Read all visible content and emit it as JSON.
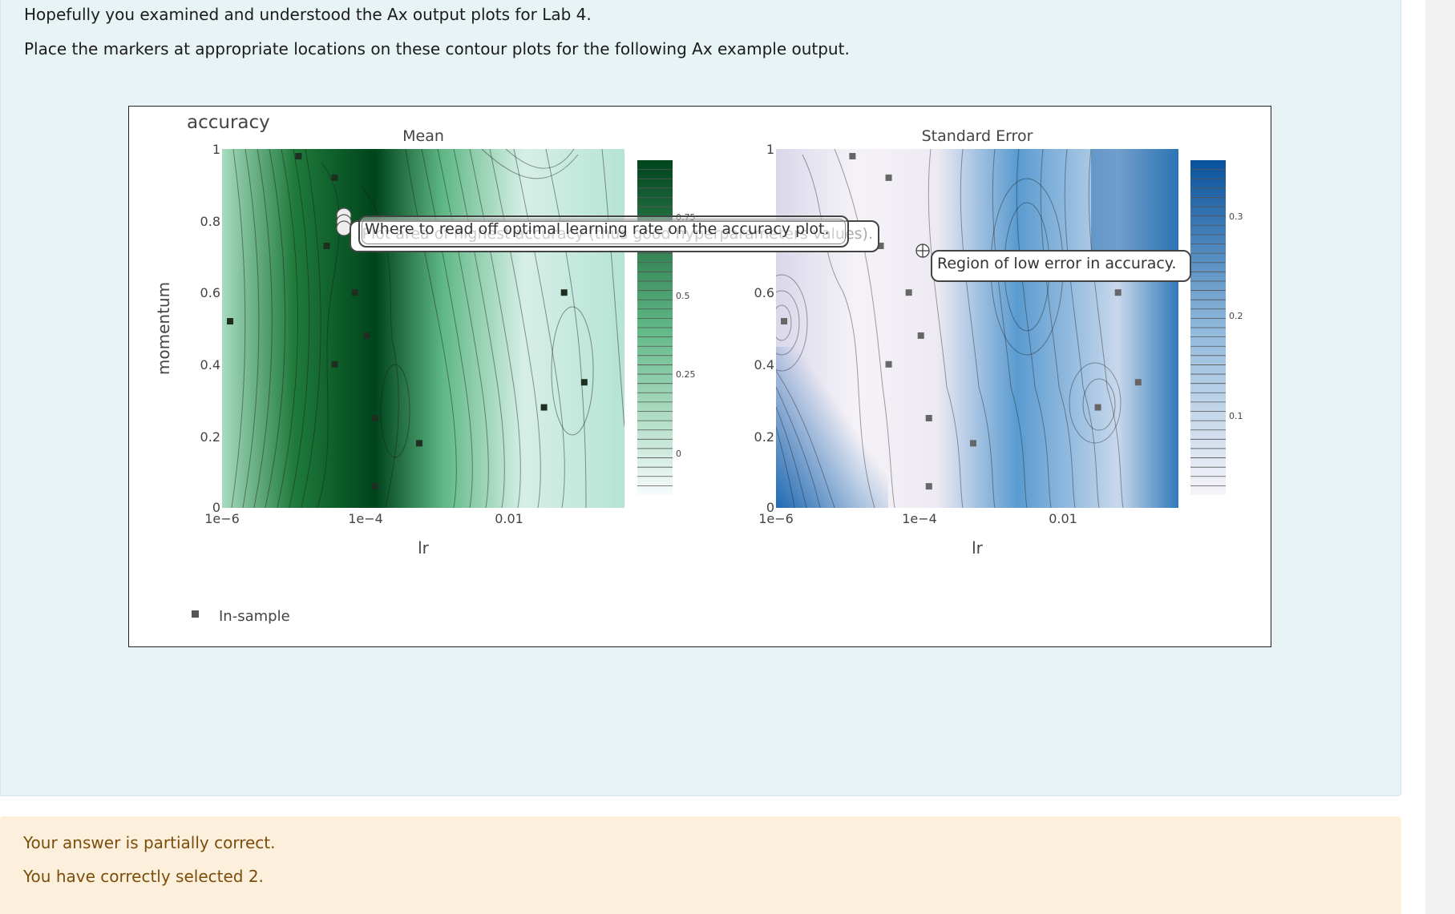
{
  "question": {
    "line1": "Hopefully you examined and understood the Ax output plots for Lab 4.",
    "line2": "Place the markers at appropriate locations on these contour plots for the following Ax example output."
  },
  "plot": {
    "title": "accuracy",
    "left_subtitle": "Mean",
    "right_subtitle": "Standard Error",
    "y_axis_label": "momentum",
    "x_axis_label": "lr",
    "y_ticks": [
      "1",
      "0.8",
      "0.6",
      "0.4",
      "0.2",
      "0"
    ],
    "x_ticks": [
      "1e−6",
      "1e−4",
      "0.01"
    ],
    "left_colorbar_ticks": [
      "0.75",
      "0.5",
      "0.25",
      "0"
    ],
    "right_colorbar_ticks": [
      "0.3",
      "0.2",
      "0.1"
    ],
    "legend_label": "In-sample",
    "left_colors": {
      "dark": "#00441b",
      "mid": "#41ab5d",
      "light": "#e5f5f9"
    },
    "right_colors": {
      "dark": "#08519c",
      "mid": "#6baed6",
      "light": "#f5f2f7"
    }
  },
  "markers": {
    "label_back": "Plot area of highest accuracy (thus good hyperparameters values).",
    "label_front": "Where to read off optimal learning rate on the accuracy plot.",
    "label_right": "Region of low error in accuracy."
  },
  "feedback": {
    "line1": "Your answer is partially correct.",
    "line2": "You have correctly selected 2."
  },
  "sample_points": {
    "mean": [
      [
        0.19,
        0.98
      ],
      [
        0.28,
        0.92
      ],
      [
        0.26,
        0.73
      ],
      [
        0.33,
        0.6
      ],
      [
        0.36,
        0.48
      ],
      [
        0.28,
        0.4
      ],
      [
        0.38,
        0.25
      ],
      [
        0.49,
        0.18
      ],
      [
        0.38,
        0.06
      ],
      [
        0.85,
        0.6
      ],
      [
        0.8,
        0.28
      ],
      [
        0.9,
        0.35
      ],
      [
        0.02,
        0.52
      ]
    ],
    "se": [
      [
        0.19,
        0.98
      ],
      [
        0.28,
        0.92
      ],
      [
        0.26,
        0.73
      ],
      [
        0.33,
        0.6
      ],
      [
        0.36,
        0.48
      ],
      [
        0.28,
        0.4
      ],
      [
        0.38,
        0.25
      ],
      [
        0.49,
        0.18
      ],
      [
        0.38,
        0.06
      ],
      [
        0.85,
        0.6
      ],
      [
        0.8,
        0.28
      ],
      [
        0.9,
        0.35
      ],
      [
        0.02,
        0.52
      ]
    ]
  }
}
